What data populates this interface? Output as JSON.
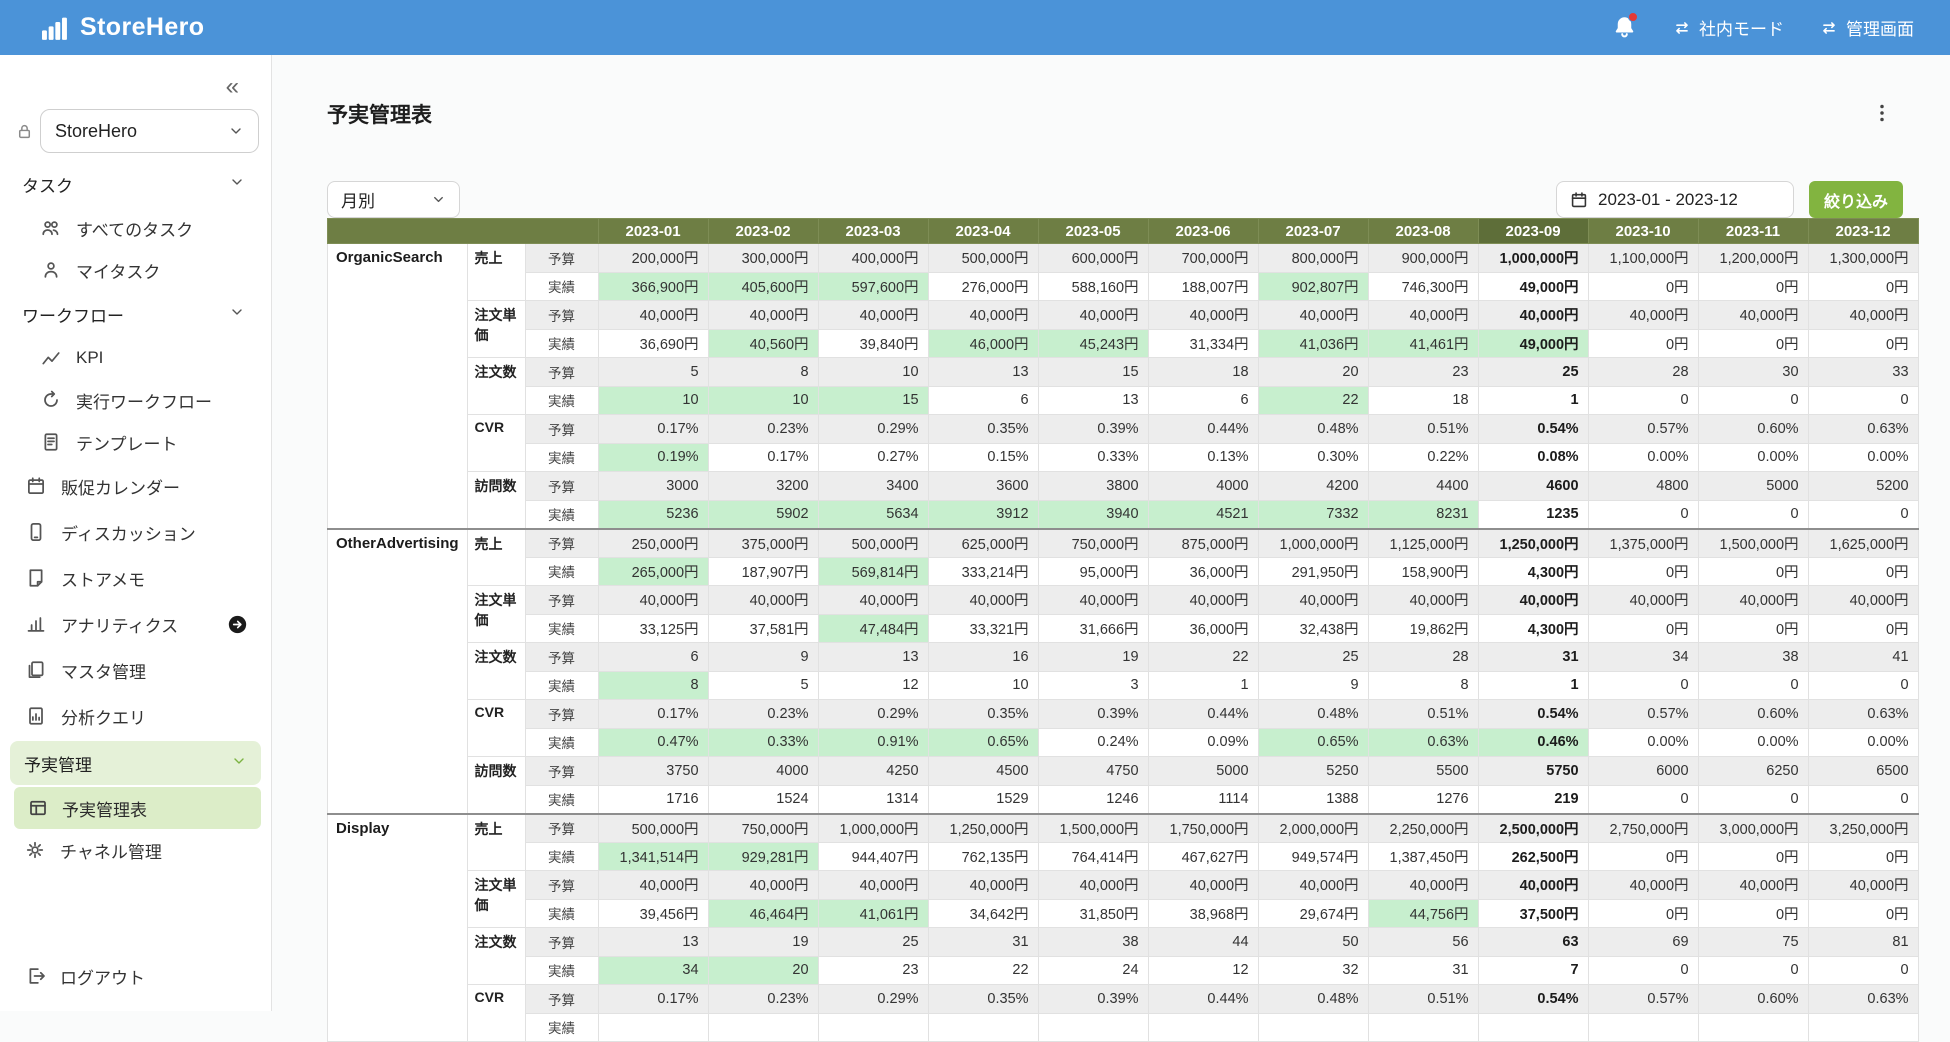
{
  "colors": {
    "topbar_blue": "#4b93d8",
    "table_header_olive": "#6e7e44",
    "table_header_olive_highlight": "#5e6e39",
    "highlight_green": "#c7efce",
    "filter_button_green": "#82b440",
    "sidebar_active_green": "#dcedc8",
    "sidebar_section_green": "#e5f1d8",
    "notification_red": "#e53935"
  },
  "topbar": {
    "brand": "StoreHero",
    "mode_switch": "社内モード",
    "admin_switch": "管理画面"
  },
  "sidebar": {
    "collapse_icon": "«",
    "store_selector": "StoreHero",
    "tasks_label": "タスク",
    "all_tasks": "すべてのタスク",
    "my_tasks": "マイタスク",
    "workflow_label": "ワークフロー",
    "kpi": "KPI",
    "exec_workflow": "実行ワークフロー",
    "template": "テンプレート",
    "promo_calendar": "販促カレンダー",
    "discussion": "ディスカッション",
    "store_memo": "ストアメモ",
    "analytics": "アナリティクス",
    "master_mgmt": "マスタ管理",
    "analysis_query": "分析クエリ",
    "budget_label": "予実管理",
    "budget_table": "予実管理表",
    "channel_mgmt": "チャネル管理",
    "logout": "ログアウト"
  },
  "main": {
    "title": "予実管理表",
    "granularity": "月別",
    "date_range": "2023-01  -  2023-12",
    "filter_button": "絞り込み"
  },
  "table": {
    "months": [
      "2023-01",
      "2023-02",
      "2023-03",
      "2023-04",
      "2023-05",
      "2023-06",
      "2023-07",
      "2023-08",
      "2023-09",
      "2023-10",
      "2023-11",
      "2023-12"
    ],
    "highlight_month": "2023-09",
    "row_type_labels": {
      "budget": "予算",
      "actual": "実績"
    },
    "channels": [
      {
        "name": "OrganicSearch",
        "metrics": [
          {
            "label": "売上",
            "budget": [
              "200,000円",
              "300,000円",
              "400,000円",
              "500,000円",
              "600,000円",
              "700,000円",
              "800,000円",
              "900,000円",
              "1,000,000円",
              "1,100,000円",
              "1,200,000円",
              "1,300,000円"
            ],
            "actual": [
              "366,900円",
              "405,600円",
              "597,600円",
              "276,000円",
              "588,160円",
              "188,007円",
              "902,807円",
              "746,300円",
              "49,000円",
              "0円",
              "0円",
              "0円"
            ],
            "actual_hl": [
              1,
              1,
              1,
              0,
              0,
              0,
              1,
              0,
              0,
              0,
              0,
              0
            ]
          },
          {
            "label": "注文単価",
            "budget": [
              "40,000円",
              "40,000円",
              "40,000円",
              "40,000円",
              "40,000円",
              "40,000円",
              "40,000円",
              "40,000円",
              "40,000円",
              "40,000円",
              "40,000円",
              "40,000円"
            ],
            "actual": [
              "36,690円",
              "40,560円",
              "39,840円",
              "46,000円",
              "45,243円",
              "31,334円",
              "41,036円",
              "41,461円",
              "49,000円",
              "0円",
              "0円",
              "0円"
            ],
            "actual_hl": [
              0,
              1,
              0,
              1,
              1,
              0,
              1,
              1,
              1,
              0,
              0,
              0
            ]
          },
          {
            "label": "注文数",
            "budget": [
              "5",
              "8",
              "10",
              "13",
              "15",
              "18",
              "20",
              "23",
              "25",
              "28",
              "30",
              "33"
            ],
            "actual": [
              "10",
              "10",
              "15",
              "6",
              "13",
              "6",
              "22",
              "18",
              "1",
              "0",
              "0",
              "0"
            ],
            "actual_hl": [
              1,
              1,
              1,
              0,
              0,
              0,
              1,
              0,
              0,
              0,
              0,
              0
            ]
          },
          {
            "label": "CVR",
            "budget": [
              "0.17%",
              "0.23%",
              "0.29%",
              "0.35%",
              "0.39%",
              "0.44%",
              "0.48%",
              "0.51%",
              "0.54%",
              "0.57%",
              "0.60%",
              "0.63%"
            ],
            "actual": [
              "0.19%",
              "0.17%",
              "0.27%",
              "0.15%",
              "0.33%",
              "0.13%",
              "0.30%",
              "0.22%",
              "0.08%",
              "0.00%",
              "0.00%",
              "0.00%"
            ],
            "actual_hl": [
              1,
              0,
              0,
              0,
              0,
              0,
              0,
              0,
              0,
              0,
              0,
              0
            ]
          },
          {
            "label": "訪問数",
            "budget": [
              "3000",
              "3200",
              "3400",
              "3600",
              "3800",
              "4000",
              "4200",
              "4400",
              "4600",
              "4800",
              "5000",
              "5200"
            ],
            "actual": [
              "5236",
              "5902",
              "5634",
              "3912",
              "3940",
              "4521",
              "7332",
              "8231",
              "1235",
              "0",
              "0",
              "0"
            ],
            "actual_hl": [
              1,
              1,
              1,
              1,
              1,
              1,
              1,
              1,
              0,
              0,
              0,
              0
            ]
          }
        ]
      },
      {
        "name": "OtherAdvertising",
        "metrics": [
          {
            "label": "売上",
            "budget": [
              "250,000円",
              "375,000円",
              "500,000円",
              "625,000円",
              "750,000円",
              "875,000円",
              "1,000,000円",
              "1,125,000円",
              "1,250,000円",
              "1,375,000円",
              "1,500,000円",
              "1,625,000円"
            ],
            "actual": [
              "265,000円",
              "187,907円",
              "569,814円",
              "333,214円",
              "95,000円",
              "36,000円",
              "291,950円",
              "158,900円",
              "4,300円",
              "0円",
              "0円",
              "0円"
            ],
            "actual_hl": [
              1,
              0,
              1,
              0,
              0,
              0,
              0,
              0,
              0,
              0,
              0,
              0
            ]
          },
          {
            "label": "注文単価",
            "budget": [
              "40,000円",
              "40,000円",
              "40,000円",
              "40,000円",
              "40,000円",
              "40,000円",
              "40,000円",
              "40,000円",
              "40,000円",
              "40,000円",
              "40,000円",
              "40,000円"
            ],
            "actual": [
              "33,125円",
              "37,581円",
              "47,484円",
              "33,321円",
              "31,666円",
              "36,000円",
              "32,438円",
              "19,862円",
              "4,300円",
              "0円",
              "0円",
              "0円"
            ],
            "actual_hl": [
              0,
              0,
              1,
              0,
              0,
              0,
              0,
              0,
              0,
              0,
              0,
              0
            ]
          },
          {
            "label": "注文数",
            "budget": [
              "6",
              "9",
              "13",
              "16",
              "19",
              "22",
              "25",
              "28",
              "31",
              "34",
              "38",
              "41"
            ],
            "actual": [
              "8",
              "5",
              "12",
              "10",
              "3",
              "1",
              "9",
              "8",
              "1",
              "0",
              "0",
              "0"
            ],
            "actual_hl": [
              1,
              0,
              0,
              0,
              0,
              0,
              0,
              0,
              0,
              0,
              0,
              0
            ]
          },
          {
            "label": "CVR",
            "budget": [
              "0.17%",
              "0.23%",
              "0.29%",
              "0.35%",
              "0.39%",
              "0.44%",
              "0.48%",
              "0.51%",
              "0.54%",
              "0.57%",
              "0.60%",
              "0.63%"
            ],
            "actual": [
              "0.47%",
              "0.33%",
              "0.91%",
              "0.65%",
              "0.24%",
              "0.09%",
              "0.65%",
              "0.63%",
              "0.46%",
              "0.00%",
              "0.00%",
              "0.00%"
            ],
            "actual_hl": [
              1,
              1,
              1,
              1,
              0,
              0,
              1,
              1,
              1,
              0,
              0,
              0
            ]
          },
          {
            "label": "訪問数",
            "budget": [
              "3750",
              "4000",
              "4250",
              "4500",
              "4750",
              "5000",
              "5250",
              "5500",
              "5750",
              "6000",
              "6250",
              "6500"
            ],
            "actual": [
              "1716",
              "1524",
              "1314",
              "1529",
              "1246",
              "1114",
              "1388",
              "1276",
              "219",
              "0",
              "0",
              "0"
            ],
            "actual_hl": [
              0,
              0,
              0,
              0,
              0,
              0,
              0,
              0,
              0,
              0,
              0,
              0
            ]
          }
        ]
      },
      {
        "name": "Display",
        "metrics": [
          {
            "label": "売上",
            "budget": [
              "500,000円",
              "750,000円",
              "1,000,000円",
              "1,250,000円",
              "1,500,000円",
              "1,750,000円",
              "2,000,000円",
              "2,250,000円",
              "2,500,000円",
              "2,750,000円",
              "3,000,000円",
              "3,250,000円"
            ],
            "actual": [
              "1,341,514円",
              "929,281円",
              "944,407円",
              "762,135円",
              "764,414円",
              "467,627円",
              "949,574円",
              "1,387,450円",
              "262,500円",
              "0円",
              "0円",
              "0円"
            ],
            "actual_hl": [
              1,
              1,
              0,
              0,
              0,
              0,
              0,
              0,
              0,
              0,
              0,
              0
            ]
          },
          {
            "label": "注文単価",
            "budget": [
              "40,000円",
              "40,000円",
              "40,000円",
              "40,000円",
              "40,000円",
              "40,000円",
              "40,000円",
              "40,000円",
              "40,000円",
              "40,000円",
              "40,000円",
              "40,000円"
            ],
            "actual": [
              "39,456円",
              "46,464円",
              "41,061円",
              "34,642円",
              "31,850円",
              "38,968円",
              "29,674円",
              "44,756円",
              "37,500円",
              "0円",
              "0円",
              "0円"
            ],
            "actual_hl": [
              0,
              1,
              1,
              0,
              0,
              0,
              0,
              1,
              0,
              0,
              0,
              0
            ]
          },
          {
            "label": "注文数",
            "budget": [
              "13",
              "19",
              "25",
              "31",
              "38",
              "44",
              "50",
              "56",
              "63",
              "69",
              "75",
              "81"
            ],
            "actual": [
              "34",
              "20",
              "23",
              "22",
              "24",
              "12",
              "32",
              "31",
              "7",
              "0",
              "0",
              "0"
            ],
            "actual_hl": [
              1,
              1,
              0,
              0,
              0,
              0,
              0,
              0,
              0,
              0,
              0,
              0
            ]
          },
          {
            "label": "CVR",
            "budget": [
              "0.17%",
              "0.23%",
              "0.29%",
              "0.35%",
              "0.39%",
              "0.44%",
              "0.48%",
              "0.51%",
              "0.54%",
              "0.57%",
              "0.60%",
              "0.63%"
            ],
            "actual": [
              "",
              "",
              "",
              "",
              "",
              "",
              "",
              "",
              "",
              "",
              "",
              ""
            ],
            "actual_hl": [
              0,
              0,
              0,
              0,
              0,
              0,
              0,
              0,
              0,
              0,
              0,
              0
            ]
          }
        ]
      }
    ]
  }
}
